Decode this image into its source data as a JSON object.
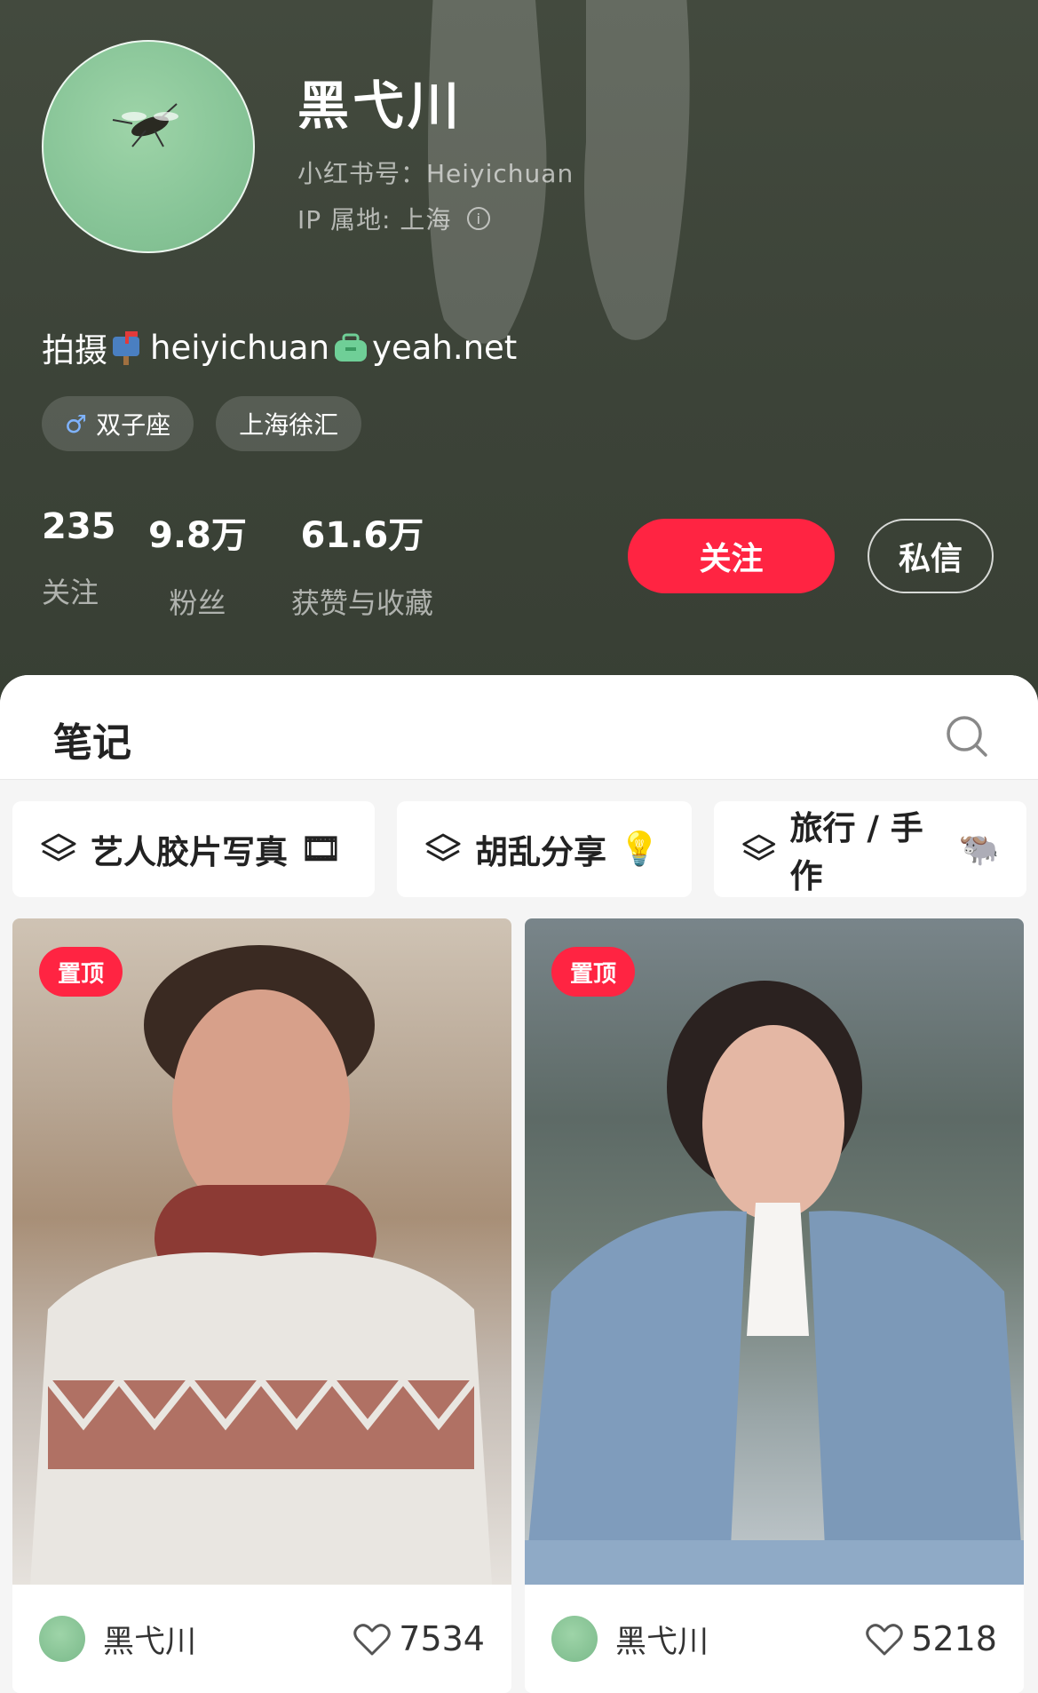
{
  "profile": {
    "name": "黑弋川",
    "id_line": "小红书号：Heiyichuan",
    "ip_line": "IP 属地: 上海",
    "bio_prefix": "拍摄",
    "bio_user": "heiyichuan",
    "bio_domain": "yeah.net",
    "tags": [
      {
        "icon": "male-symbol-icon",
        "icon_glyph": "♂",
        "label": "双子座"
      },
      {
        "label": "上海徐汇"
      }
    ]
  },
  "stats": [
    {
      "value": "235",
      "label": "关注"
    },
    {
      "value": "9.8万",
      "label": "粉丝"
    },
    {
      "value": "61.6万",
      "label": "获赞与收藏"
    }
  ],
  "actions": {
    "follow": "关注",
    "message": "私信"
  },
  "tabs": {
    "notes": "笔记"
  },
  "collections": [
    {
      "label": "艺人胶片写真",
      "emoji": "🎞"
    },
    {
      "label": "胡乱分享",
      "emoji": "💡"
    },
    {
      "label": "旅行 / 手作",
      "emoji": "🐃"
    }
  ],
  "notes": [
    {
      "pinned": "置顶",
      "author": "黑弋川",
      "likes": "7534"
    },
    {
      "pinned": "置顶",
      "author": "黑弋川",
      "likes": "5218"
    }
  ],
  "colors": {
    "accent": "#ff2442",
    "header_bg": "#3c4338"
  }
}
